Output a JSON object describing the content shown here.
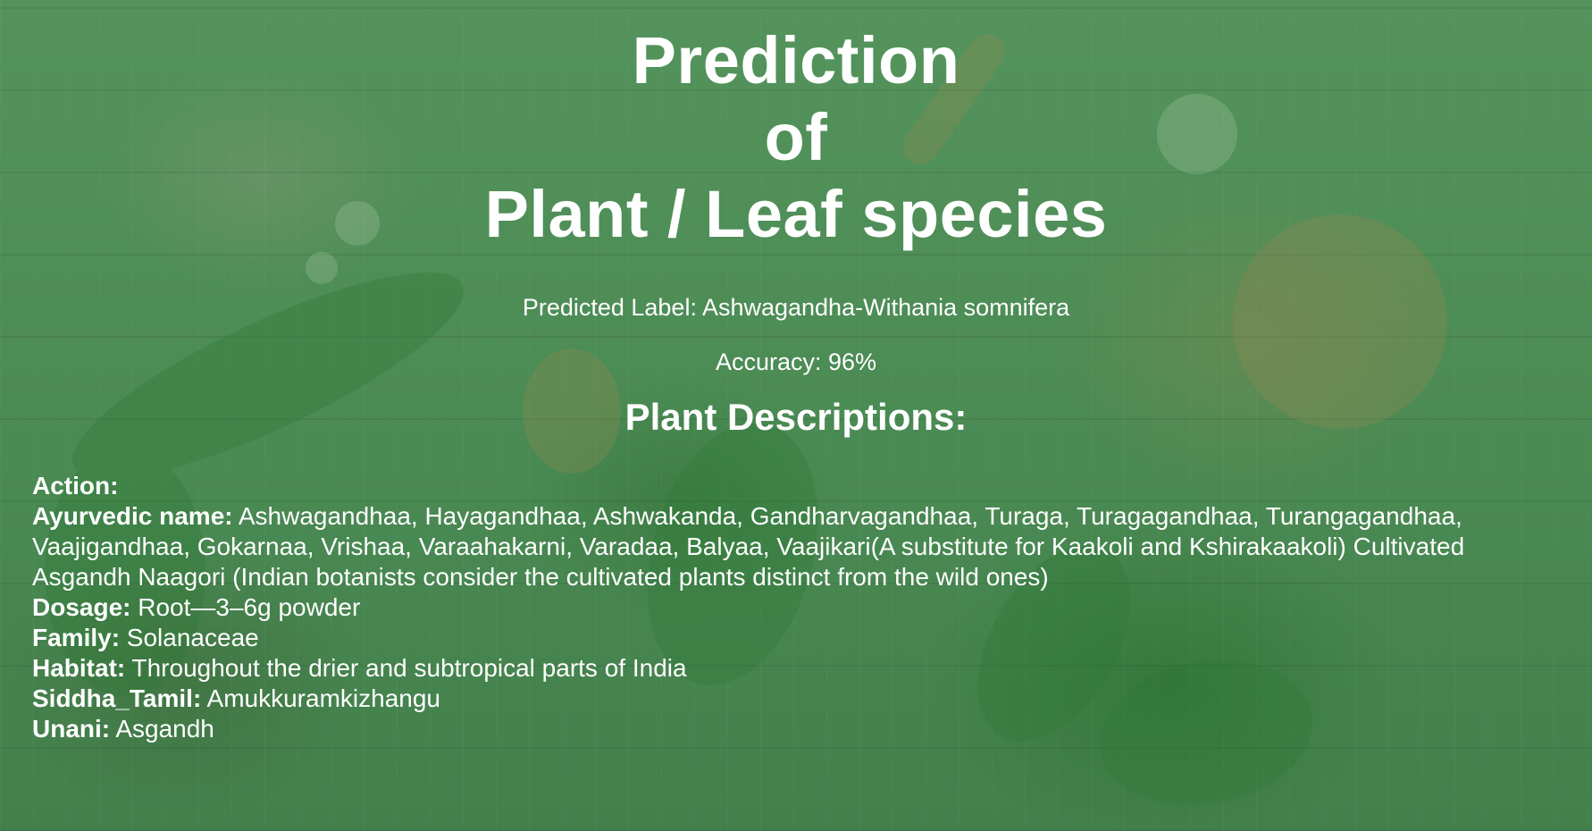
{
  "title": {
    "line1": "Prediction",
    "line2": "of",
    "line3": "Plant / Leaf species"
  },
  "prediction": {
    "label_text": "Predicted Label: Ashwagandha-Withania somnifera",
    "accuracy_text": "Accuracy: 96%"
  },
  "descriptions_heading": "Plant Descriptions:",
  "details": {
    "action": {
      "key": "Action:",
      "value": ""
    },
    "ayurvedic_name": {
      "key": "Ayurvedic name:",
      "value": " Ashwagandhaa, Hayagandhaa, Ashwakanda, Gandharvagandhaa, Turaga, Turagagandhaa, Turangagandhaa, Vaajigandhaa, Gokarnaa, Vrishaa, Varaahakarni, Varadaa, Balyaa, Vaajikari(A substitute for Kaakoli and Kshirakaakoli) Cultivated Asgandh Naagori (Indian botanists consider the cultivated plants distinct from the wild ones)"
    },
    "dosage": {
      "key": "Dosage:",
      "value": " Root—3–6g powder"
    },
    "family": {
      "key": "Family:",
      "value": " Solanaceae"
    },
    "habitat": {
      "key": "Habitat:",
      "value": " Throughout the drier and subtropical parts of India"
    },
    "siddha_tamil": {
      "key": "Siddha_Tamil:",
      "value": " Amukkuramkizhangu"
    },
    "unani": {
      "key": "Unani:",
      "value": " Asgandh"
    }
  },
  "colors": {
    "overlay_green": "#4d8b55",
    "text": "#ffffff"
  }
}
